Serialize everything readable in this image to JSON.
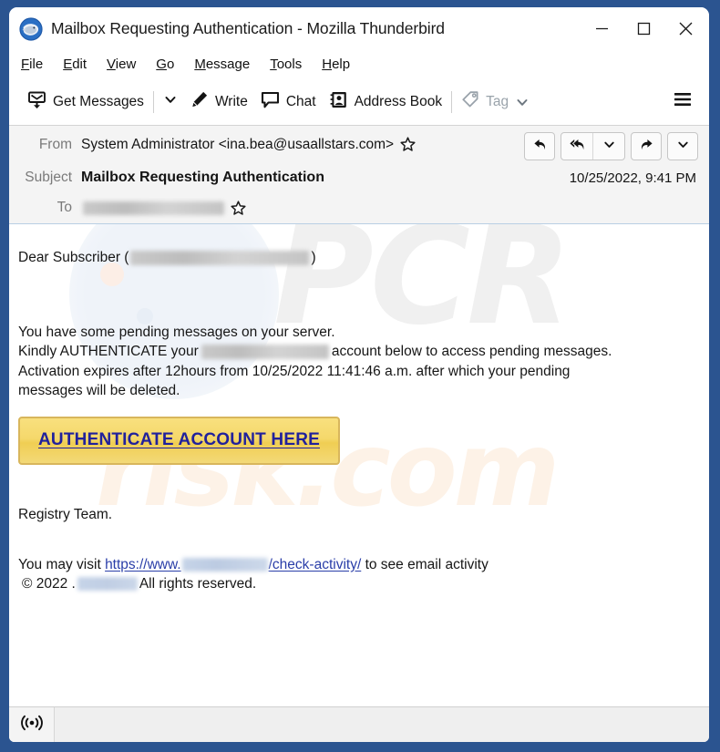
{
  "window": {
    "title": "Mailbox Requesting Authentication - Mozilla Thunderbird",
    "app_icon": "thunderbird-logo",
    "controls": {
      "minimize": "minimize-icon",
      "maximize": "maximize-icon",
      "close": "close-icon"
    }
  },
  "menubar": {
    "items": [
      {
        "label": "File",
        "accel": "F",
        "rest": "ile"
      },
      {
        "label": "Edit",
        "accel": "E",
        "rest": "dit"
      },
      {
        "label": "View",
        "accel": "V",
        "rest": "iew"
      },
      {
        "label": "Go",
        "accel": "G",
        "rest": "o"
      },
      {
        "label": "Message",
        "accel": "M",
        "rest": "essage"
      },
      {
        "label": "Tools",
        "accel": "T",
        "rest": "ools"
      },
      {
        "label": "Help",
        "accel": "H",
        "rest": "elp"
      }
    ]
  },
  "toolbar": {
    "get_messages_label": "Get Messages",
    "get_messages_icon": "inbox-download-icon",
    "get_messages_caret": "chevron-down-icon",
    "write_label": "Write",
    "write_icon": "pencil-icon",
    "chat_label": "Chat",
    "chat_icon": "speech-bubble-icon",
    "address_book_label": "Address Book",
    "address_book_icon": "contact-card-icon",
    "tag_label": "Tag",
    "tag_icon": "tag-icon",
    "tag_caret": "chevron-down-icon",
    "tag_disabled": true,
    "menu_icon": "hamburger-menu-icon"
  },
  "message_header": {
    "from_label": "From",
    "from_value": "System Administrator <ina.bea@usaallstars.com>",
    "from_star_icon": "star-outline-icon",
    "subject_label": "Subject",
    "subject_value": "Mailbox Requesting Authentication",
    "date": "10/25/2022, 9:41 PM",
    "to_label": "To",
    "to_value_redacted": true,
    "to_star_icon": "star-outline-icon",
    "actions": {
      "reply_icon": "reply-arrow-icon",
      "reply_all_icon": "reply-all-arrow-icon",
      "reply_all_caret": "chevron-down-icon",
      "forward_icon": "forward-arrow-icon",
      "more_caret": "chevron-down-icon"
    }
  },
  "body": {
    "greeting_prefix": "Dear Subscriber (",
    "greeting_suffix": ")",
    "line1": "You have some pending messages on your server.",
    "line2_prefix": "Kindly AUTHENTICATE your",
    "line2_suffix": "account below to access pending messages.",
    "line3": "Activation expires after 12hours from 10/25/2022 11:41:46 a.m. after which your pending",
    "line4": "messages will be deleted.",
    "cta_label": "AUTHENTICATE ACCOUNT HERE",
    "signature": "Registry Team.",
    "footer_prefix": "You may visit",
    "footer_url_visible": "https://www.",
    "footer_url_tail": "/check-activity/",
    "footer_suffix": "to see email activity",
    "copyright_prefix": "© 2022 .",
    "copyright_suffix": "All rights reserved.",
    "watermark_top": "PCR",
    "watermark_bottom": "risk.com"
  },
  "statusbar": {
    "connection_icon": "broadcast-signal-icon"
  },
  "colors": {
    "window_border": "#2b5490",
    "header_bg": "#f4f4f4",
    "cta_bg": "#f3d86d",
    "cta_border": "#d8b65c",
    "cta_text": "#21219c",
    "link": "#2a3ea8",
    "statusbar_bg": "#efefef"
  }
}
